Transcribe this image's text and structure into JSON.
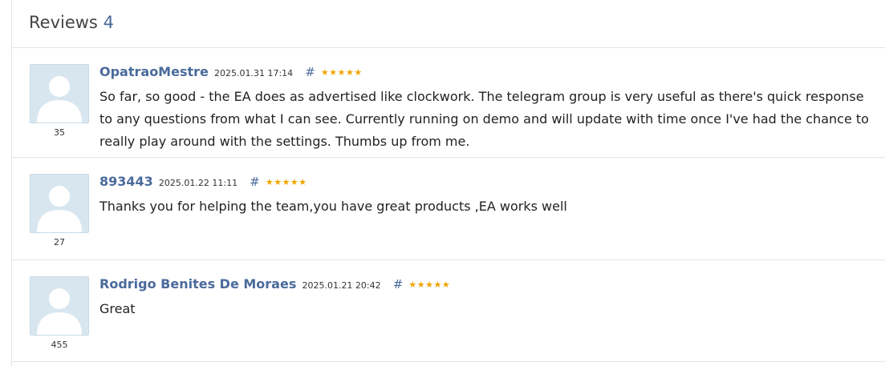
{
  "header": {
    "title": "Reviews",
    "count": "4"
  },
  "reviews": [
    {
      "author": "OpatraoMestre",
      "date": "2025.01.31 17:14",
      "hash": "#",
      "stars": "★★★★★",
      "rating_count": "35",
      "text": "So far, so good - the EA does as advertised like clockwork. The telegram group is very useful as there's quick response to any questions from what I can see. Currently running on demo and will update with time once I've had the chance to really play around with the settings. Thumbs up from me."
    },
    {
      "author": "893443",
      "date": "2025.01.22 11:11",
      "hash": "#",
      "stars": "★★★★★",
      "rating_count": "27",
      "text": "Thanks you for helping the team,you have great products ,EA works well"
    },
    {
      "author": "Rodrigo Benites De Moraes",
      "date": "2025.01.21 20:42",
      "hash": "#",
      "stars": "★★★★★",
      "rating_count": "455",
      "text": "Great"
    }
  ],
  "colors": {
    "link": "#4a6a9b",
    "star": "#f0a500",
    "avatar_bg": "#d8e6ef"
  }
}
